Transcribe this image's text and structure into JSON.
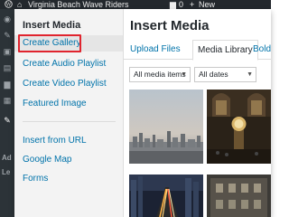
{
  "admin_bar": {
    "site_name": "Virginia Beach Wave Riders",
    "comments_count": "0",
    "new_label": "New"
  },
  "wp_sidebar": {
    "partial_label_1": "Ad",
    "partial_label_2": "Le"
  },
  "modal": {
    "menu": {
      "title": "Insert Media",
      "items": [
        {
          "label": "Create Gallery"
        },
        {
          "label": "Create Audio Playlist"
        },
        {
          "label": "Create Video Playlist"
        },
        {
          "label": "Featured Image"
        },
        {
          "label": "Insert from URL"
        },
        {
          "label": "Google Map"
        },
        {
          "label": "Forms"
        }
      ]
    },
    "title": "Insert Media",
    "tabs": [
      {
        "label": "Upload Files"
      },
      {
        "label": "Media Library"
      },
      {
        "label": "BoldGrid C"
      }
    ],
    "filters": {
      "type_selected": "All media items",
      "date_selected": "All dates"
    }
  },
  "colors": {
    "link": "#0073aa",
    "highlight_box": "#e0242e",
    "admin_bar_bg": "#23282d"
  }
}
